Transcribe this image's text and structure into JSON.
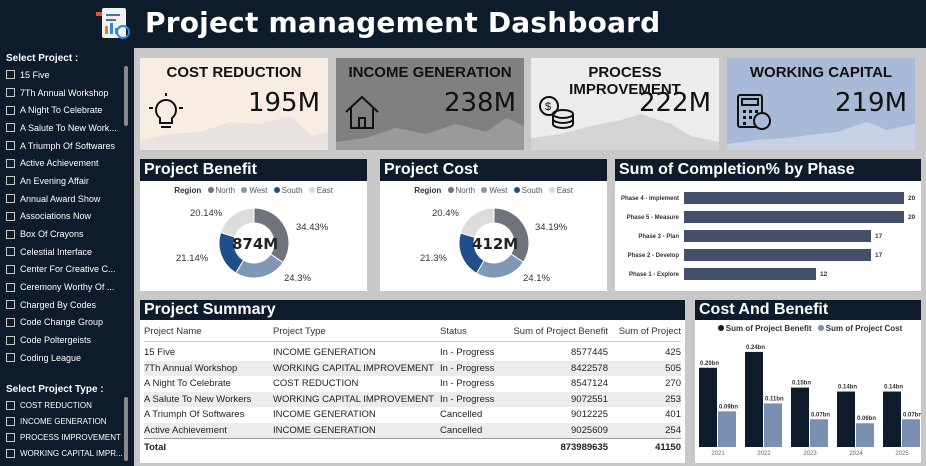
{
  "header": {
    "title": "Project management Dashboard"
  },
  "sidebar": {
    "project_heading": "Select Project :",
    "projects": [
      "15 Five",
      "7Th Annual Workshop",
      "A Night To Celebrate",
      "A Salute To New Work...",
      "A Triumph Of Softwares",
      "Active Achievement",
      "An Evening Affair",
      "Annual Award Show",
      "Associations Now",
      "Box Of Crayons",
      "Celestial Interface",
      "Center For Creative C...",
      "Ceremony Worthy Of ...",
      "Charged By Codes",
      "Code Change Group",
      "Code Poltergeists",
      "Coding League"
    ],
    "type_heading": "Select Project Type :",
    "types": [
      "COST REDUCTION",
      "INCOME GENERATION",
      "PROCESS IMPROVEMENT",
      "WORKING CAPITAL IMPR..."
    ]
  },
  "kpis": [
    {
      "label": "COST REDUCTION",
      "value": "195M",
      "icon": "lightbulb-icon",
      "bg": "#f8ede3",
      "fg": "#111111",
      "spark": "#e8e3de"
    },
    {
      "label": "INCOME GENERATION",
      "value": "238M",
      "icon": "house-icon",
      "bg": "#808080",
      "fg": "#111111",
      "spark": "#9a9a9a"
    },
    {
      "label": "PROCESS IMPROVEMENT",
      "value": "222M",
      "icon": "coins-icon",
      "bg": "#ececec",
      "fg": "#111111",
      "spark": "#d4d4d4"
    },
    {
      "label": "WORKING CAPITAL",
      "value": "219M",
      "icon": "calculator-icon",
      "bg": "#a9bad8",
      "fg": "#111111",
      "spark": "#c6d1e5"
    }
  ],
  "benefit": {
    "title": "Project Benefit",
    "legend_title": "Region",
    "regions": [
      "North",
      "West",
      "South",
      "East"
    ],
    "center": "874M",
    "slices": [
      34.43,
      24.3,
      21.14,
      20.14
    ],
    "labels": [
      "34.43%",
      "24.3%",
      "21.14%",
      "20.14%"
    ]
  },
  "cost": {
    "title": "Project Cost",
    "legend_title": "Region",
    "regions": [
      "North",
      "West",
      "South",
      "East"
    ],
    "center": "412M",
    "slices": [
      34.19,
      24.1,
      21.3,
      20.4
    ],
    "labels": [
      "34.19%",
      "24.1%",
      "21.3%",
      "20.4%"
    ]
  },
  "completion": {
    "title": "Sum of Completion% by Phase",
    "phases": [
      "Phase 4 - Implement",
      "Phase 5 - Measure",
      "Phase 3 - Plan",
      "Phase 2 - Develop",
      "Phase 1 - Explore"
    ],
    "values": [
      20,
      20,
      17,
      17,
      12
    ]
  },
  "summary": {
    "title": "Project Summary",
    "columns": [
      "Project Name",
      "Project Type",
      "Status",
      "Sum of Project Benefit",
      "Sum of Project"
    ],
    "rows": [
      [
        "15 Five",
        "INCOME GENERATION",
        "In - Progress",
        "8577445",
        "425"
      ],
      [
        "7Th Annual Workshop",
        "WORKING CAPITAL IMPROVEMENT",
        "In - Progress",
        "8422578",
        "505"
      ],
      [
        "A Night To Celebrate",
        "COST REDUCTION",
        "In - Progress",
        "8547124",
        "270"
      ],
      [
        "A Salute To New Workers",
        "WORKING CAPITAL IMPROVEMENT",
        "In - Progress",
        "9072551",
        "253"
      ],
      [
        "A Triumph Of Softwares",
        "INCOME GENERATION",
        "Cancelled",
        "9012225",
        "401"
      ],
      [
        "Active Achievement",
        "INCOME GENERATION",
        "Cancelled",
        "9025609",
        "254"
      ]
    ],
    "total_label": "Total",
    "total_benefit": "873989635",
    "total_cost": "41150"
  },
  "chart_data": {
    "type": "bar",
    "title": "Cost And Benefit",
    "categories": [
      "2021",
      "2022",
      "2023",
      "2024",
      "2025"
    ],
    "series": [
      {
        "name": "Sum of Project Benefit",
        "values": [
          0.2,
          0.24,
          0.15,
          0.14,
          0.14
        ],
        "labels": [
          "0.20bn",
          "0.24bn",
          "0.15bn",
          "0.14bn",
          "0.14bn"
        ],
        "color": "#0d1b2a"
      },
      {
        "name": "Sum of Project Cost",
        "values": [
          0.09,
          0.11,
          0.07,
          0.06,
          0.07
        ],
        "labels": [
          "0.09bn",
          "0.11bn",
          "0.07bn",
          "0.06bn",
          "0.07bn"
        ],
        "color": "#7b8fb0"
      }
    ],
    "ylim": [
      0,
      0.26
    ]
  },
  "colors": {
    "north": "#6f737b",
    "west": "#8296b6",
    "south": "#1f4e8a",
    "east": "#dcdcdc",
    "bar": "#44506a"
  }
}
